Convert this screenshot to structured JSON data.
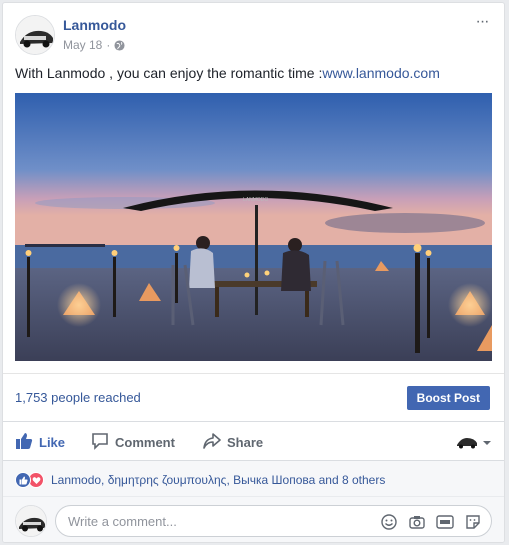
{
  "post": {
    "page_name": "Lanmodo",
    "date": "May 18",
    "separator": "·",
    "text_before_link": "With Lanmodo , you can enjoy the romantic time :",
    "link_text": "www.lanmodo.com",
    "photo_umbrella_brand": "LANMODO"
  },
  "more_menu": {
    "label": "···"
  },
  "reach": {
    "count": "1,753",
    "suffix": " people reached",
    "boost_label": "Boost Post"
  },
  "actions": {
    "like": "Like",
    "comment": "Comment",
    "share": "Share"
  },
  "reactions": {
    "text": "Lanmodo, δημητρης ζουμπουλης, Вычка Шопова and 8 others"
  },
  "comment_box": {
    "placeholder": "Write a comment..."
  },
  "colors": {
    "link_blue": "#365899",
    "like_blue": "#4267b2",
    "love_red": "#f25268",
    "muted_gray": "#90949c"
  },
  "icons": [
    "globe-icon",
    "like-icon",
    "comment-icon",
    "share-icon",
    "emoji-icon",
    "camera-icon",
    "gif-icon",
    "sticker-icon",
    "chevron-down-icon"
  ]
}
